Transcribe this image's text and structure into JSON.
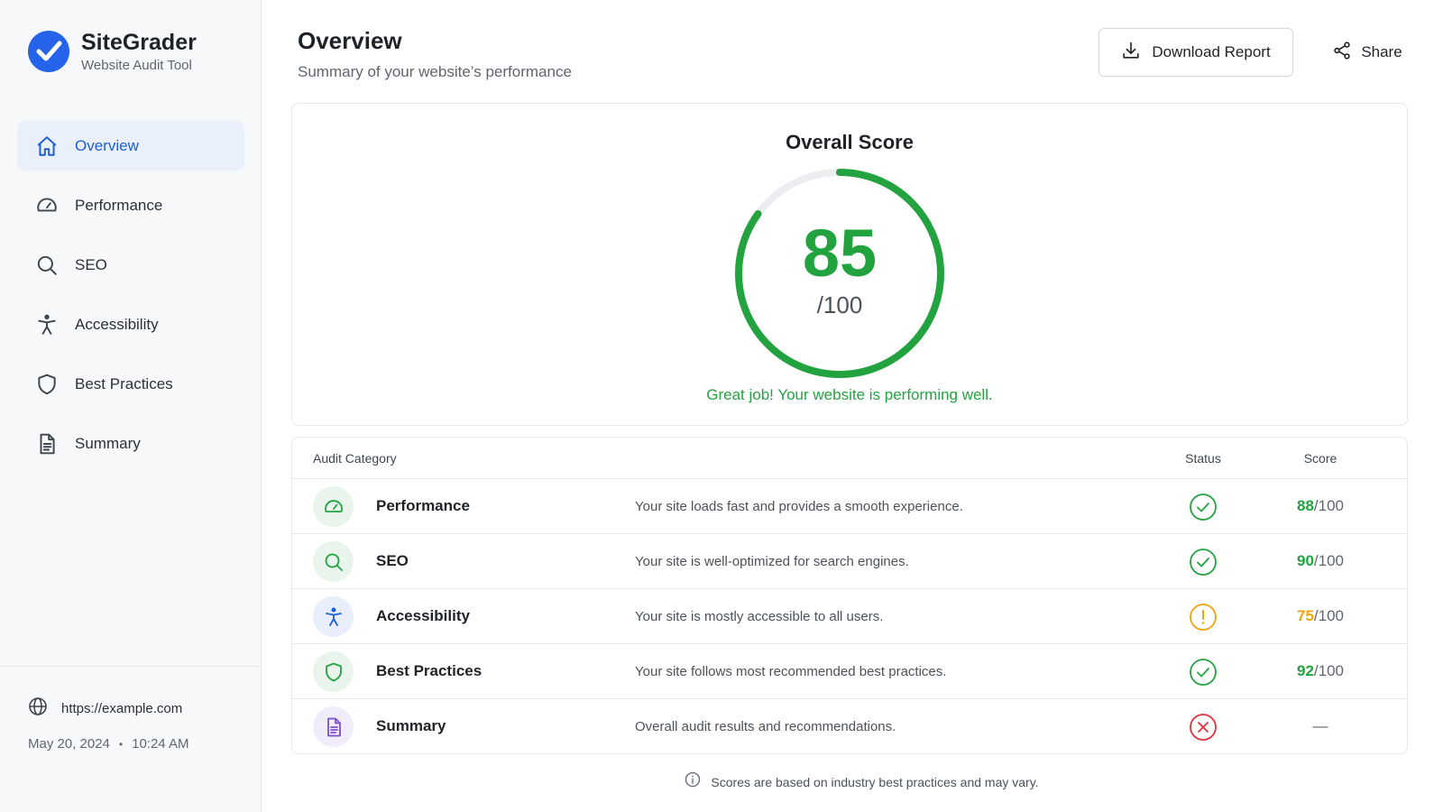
{
  "brand": {
    "name": "SiteGrader",
    "subtitle": "Website Audit Tool"
  },
  "nav": [
    {
      "label": "Overview",
      "icon": "home-icon",
      "active": true
    },
    {
      "label": "Performance",
      "icon": "gauge-icon",
      "active": false
    },
    {
      "label": "SEO",
      "icon": "search-icon",
      "active": false
    },
    {
      "label": "Accessibility",
      "icon": "accessibility-icon",
      "active": false
    },
    {
      "label": "Best Practices",
      "icon": "shield-icon",
      "active": false
    },
    {
      "label": "Summary",
      "icon": "document-icon",
      "active": false
    }
  ],
  "site": {
    "url": "https://example.com",
    "date": "May 20, 2024",
    "separator": "•",
    "time": "10:24 AM"
  },
  "header": {
    "title": "Overview",
    "subtitle": "Summary of your website’s performance",
    "download_label": "Download Report",
    "share_label": "Share"
  },
  "score": {
    "title": "Overall Score",
    "value": "85",
    "max": "/100",
    "fraction": 0.85,
    "message": "Great job! Your website is performing well."
  },
  "table": {
    "headers": {
      "category": "Audit Category",
      "status": "Status",
      "score": "Score"
    },
    "rows": [
      {
        "name": "Performance",
        "desc": "Your site loads fast and provides a smooth experience.",
        "status": "pass",
        "score": "88",
        "suffix": "/100",
        "icon": "gauge-icon"
      },
      {
        "name": "SEO",
        "desc": "Your site is well-optimized for search engines.",
        "status": "pass",
        "score": "90",
        "suffix": "/100",
        "icon": "search-icon"
      },
      {
        "name": "Accessibility",
        "desc": "Your site is mostly accessible to all users.",
        "status": "warning",
        "score": "75",
        "suffix": "/100",
        "icon": "accessibility-icon"
      },
      {
        "name": "Best Practices",
        "desc": "Your site follows most recommended best practices.",
        "status": "pass",
        "score": "92",
        "suffix": "/100",
        "icon": "shield-icon"
      },
      {
        "name": "Summary",
        "desc": "Overall audit results and recommendations.",
        "status": "fail",
        "score": "—",
        "suffix": "",
        "icon": "document-icon"
      }
    ]
  },
  "footnote": "Scores are based on industry best practices and may vary.",
  "colors": {
    "accent": "#1d5fd6",
    "pass": "#22a33f",
    "warning": "#f0a30a",
    "fail": "#e0303a",
    "purple": "#7b4fd1"
  }
}
